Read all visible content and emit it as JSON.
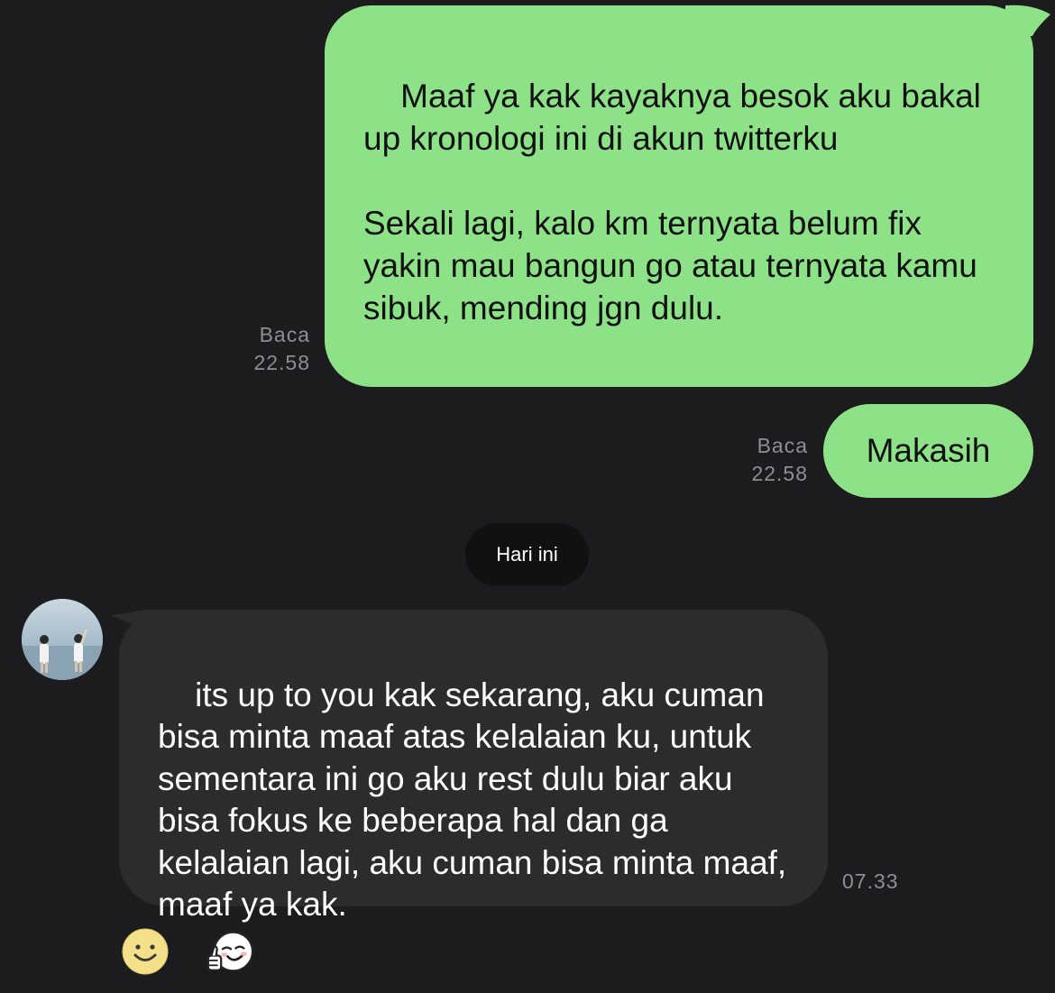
{
  "messages": {
    "outgoing_1": {
      "text": "Maaf ya kak kayaknya besok aku bakal up kronologi ini di akun twitterku\n\nSekali lagi, kalo km ternyata belum fix yakin mau bangun go atau ternyata kamu sibuk, mending jgn dulu.",
      "status": "Baca",
      "time": "22.58"
    },
    "outgoing_2": {
      "text": "Makasih",
      "status": "Baca",
      "time": "22.58"
    },
    "date_separator": "Hari ini",
    "incoming_1": {
      "text": "its up to you kak sekarang, aku cuman bisa minta maaf atas kelalaian ku, untuk sementara ini go aku rest dulu biar aku bisa fokus ke beberapa hal dan ga kelalaian lagi, aku cuman bisa minta maaf, maaf ya kak.",
      "time": "07.33"
    }
  },
  "reactions": [
    {
      "icon": "smiley-face-icon",
      "color": "#f5e08a"
    },
    {
      "icon": "thumbs-up-sticker-icon",
      "color": "#ffffff"
    }
  ],
  "colors": {
    "background": "#1c1c1e",
    "outgoing_bubble": "#8de287",
    "incoming_bubble": "#2c2c2e",
    "date_pill": "#111112",
    "meta_text": "#8e8e93"
  }
}
